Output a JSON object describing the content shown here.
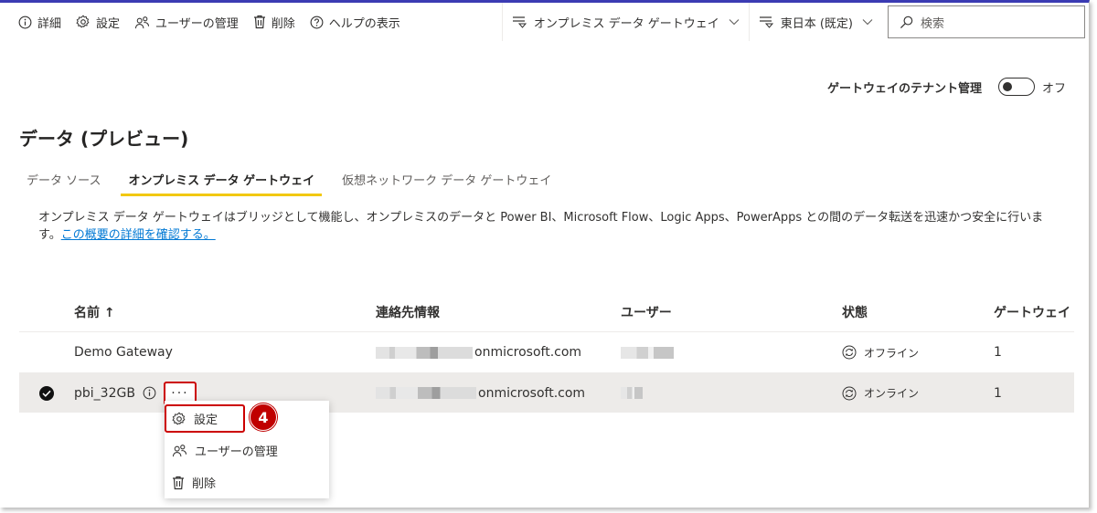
{
  "toolbar": {
    "details": "詳細",
    "settings": "設定",
    "manage_users": "ユーザーの管理",
    "delete": "削除",
    "help": "ヘルプの表示",
    "gateway_filter": "オンプレミス データ ゲートウェイ",
    "region_filter": "東日本 (既定)",
    "search_placeholder": "検索"
  },
  "tenant": {
    "label": "ゲートウェイのテナント管理",
    "state": "オフ"
  },
  "page_title": "データ (プレビュー)",
  "tabs": [
    {
      "label": "データ ソース",
      "active": false
    },
    {
      "label": "オンプレミス データ ゲートウェイ",
      "active": true
    },
    {
      "label": "仮想ネットワーク データ ゲートウェイ",
      "active": false
    }
  ],
  "description": {
    "text": "オンプレミス データ ゲートウェイはブリッジとして機能し、オンプレミスのデータと Power BI、Microsoft Flow、Logic Apps、PowerApps との間のデータ転送を迅速かつ安全に行います。",
    "link": "この概要の詳細を確認する。"
  },
  "table": {
    "columns": {
      "name": "名前 ↑",
      "contact": "連絡先情報",
      "users": "ユーザー",
      "status": "状態",
      "gateway": "ゲートウェイ"
    },
    "rows": [
      {
        "name": "Demo Gateway",
        "contact_suffix": "onmicrosoft.com",
        "status": "オフライン",
        "gateway": "1",
        "selected": false
      },
      {
        "name": "pbi_32GB",
        "contact_suffix": "onmicrosoft.com",
        "status": "オンライン",
        "gateway": "1",
        "selected": true
      }
    ]
  },
  "row_more": "···",
  "context_menu": {
    "settings": "設定",
    "manage_users": "ユーザーの管理",
    "delete": "削除"
  },
  "callout": "4",
  "colors": {
    "accent_yellow": "#f2c811",
    "highlight_red": "#c00000",
    "link_blue": "#0078d4"
  }
}
